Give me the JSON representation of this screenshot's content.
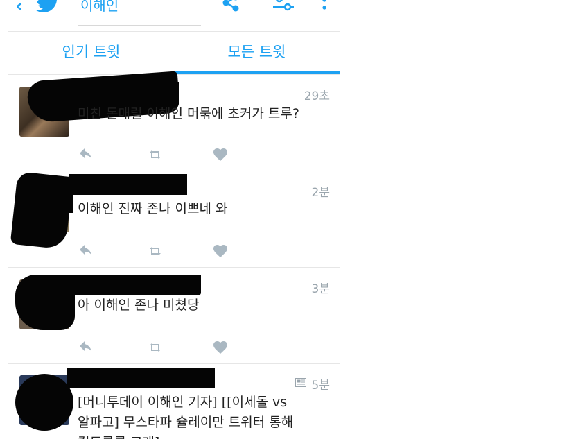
{
  "header": {
    "back_icon": "chevron-left-icon",
    "logo_icon": "twitter-bird-icon",
    "search_query": "이해인",
    "share_icon": "share-icon",
    "filter_icon": "filter-sliders-icon",
    "more_icon": "more-vertical-icon"
  },
  "tabs": [
    {
      "label": "인기 트윗",
      "active": false
    },
    {
      "label": "모든 트윗",
      "active": true
    }
  ],
  "tweets": [
    {
      "time": "29초",
      "text": "미친 돈매럴 이해인 머묶에 초커가 트루?"
    },
    {
      "time": "2분",
      "text": "이해인 진짜 존나 이쁘네 와"
    },
    {
      "time": "3분",
      "text": "아 이해인 존나 미쳤당"
    },
    {
      "time": "5분",
      "text_line1": "[머니투데이 이해인 기자] [[이세돌 vs",
      "text_line2": "알파고] 무스타파 슐레이만 트위터 통해",
      "text_line3": "컴도루루 고개]",
      "has_news_icon": true
    }
  ],
  "actions": {
    "reply_icon": "reply-icon",
    "retweet_icon": "retweet-icon",
    "like_icon": "heart-icon"
  },
  "colors": {
    "accent": "#1da1f2",
    "muted": "#9aa5ad",
    "icon_gray": "#aab8c2"
  }
}
